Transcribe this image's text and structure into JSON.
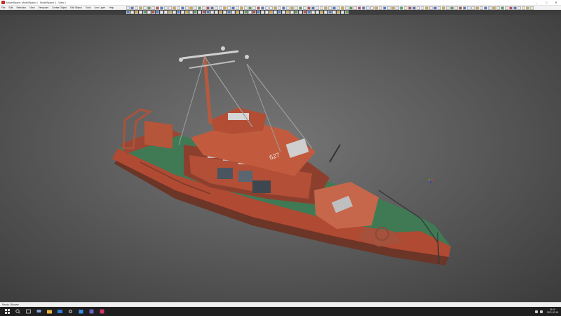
{
  "window": {
    "title": "ModelSpace: ModelSpace 1 - ModelSpace 1 - View 1",
    "controls": {
      "minimize": "–",
      "maximize": "□",
      "close": "✕"
    }
  },
  "menu": [
    "File",
    "Edit",
    "Selection",
    "View",
    "Viewpoint",
    "Create Object",
    "Edit Object",
    "Tools",
    "Live Layer",
    "Help"
  ],
  "status": {
    "text": "Ready | Browse"
  },
  "taskbar": {
    "icons": [
      "windows-start-icon",
      "search-icon",
      "task-view-icon",
      "chat-icon",
      "file-explorer-icon",
      "mail-icon",
      "settings-icon",
      "store-icon",
      "teams-icon",
      "app-icon"
    ],
    "clock_time": "16:10",
    "clock_date": "2021-02-18"
  },
  "viewport": {
    "subject": "point cloud of a ship"
  },
  "colors": {
    "hull_red": "#b04a33",
    "deck_green": "#3f7a55",
    "background": "#5c5c5c"
  }
}
